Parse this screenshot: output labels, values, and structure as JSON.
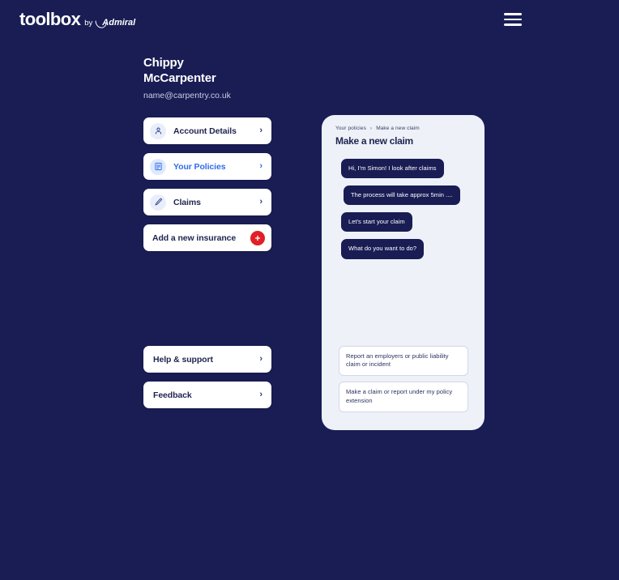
{
  "brand": {
    "logo_word": "toolbox",
    "logo_by": "by",
    "logo_admiral": "Admiral"
  },
  "header": {
    "menu_icon": "hamburger-menu-icon"
  },
  "profile": {
    "name": "Chippy McCarpenter",
    "email": "name@carpentry.co.uk"
  },
  "nav": {
    "items": [
      {
        "label": "Account Details",
        "icon": "user-icon",
        "active": false,
        "chevron": "›"
      },
      {
        "label": "Your Policies",
        "icon": "document-icon",
        "active": true,
        "chevron": "›"
      },
      {
        "label": "Claims",
        "icon": "pencil-icon",
        "active": false,
        "chevron": "›"
      }
    ],
    "add_insurance": {
      "label": "Add a new insurance",
      "icon": "plus-circle-icon",
      "accent": "#e01f26"
    }
  },
  "nav_bottom": {
    "items": [
      {
        "label": "Help & support",
        "chevron": "›"
      },
      {
        "label": "Feedback",
        "chevron": "›"
      }
    ]
  },
  "panel": {
    "breadcrumb": {
      "parent": "Your policies",
      "separator": "›",
      "current": "Make a new claim"
    },
    "title": "Make a new claim",
    "messages": [
      "Hi, I'm Simon! I look after claims",
      "The process will take approx 5min ....",
      "Let's start your claim",
      "What do you want to do?"
    ],
    "options": [
      "Report an employers or public liability claim or incident",
      "Make a claim or report under my policy extension"
    ]
  },
  "colors": {
    "background": "#191d54",
    "panel_bg": "#eef1f8",
    "card_bg": "#ffffff",
    "accent_blue": "#2f6dea",
    "accent_red": "#e01f26",
    "text_dark": "#1f2450"
  }
}
